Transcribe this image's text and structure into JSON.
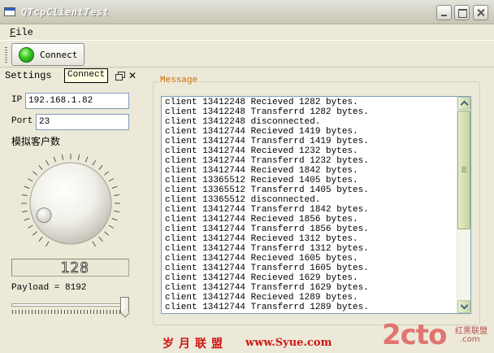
{
  "window": {
    "title": "QTcpClientTest"
  },
  "menu": {
    "file_accel": "F",
    "file_rest": "ile"
  },
  "toolbar": {
    "connect_label": "Connect"
  },
  "dock": {
    "title": "Settings",
    "tooltip": "Connect"
  },
  "settings": {
    "ip_label": "IP",
    "ip_value": "192.168.1.82",
    "port_label": "Port",
    "port_value": "23",
    "clients_label": "模拟客户数",
    "dial_value": 0.12,
    "lcd_value": "128",
    "payload_label": "Payload = 8192",
    "payload_slider_fraction": 1.0
  },
  "message": {
    "title": "Message",
    "lines": [
      "client 13412248 Recieved 1282 bytes.",
      "client 13412248 Transferrd 1282 bytes.",
      "client 13412248 disconnected.",
      "client 13412744 Recieved 1419 bytes.",
      "client 13412744 Transferrd 1419 bytes.",
      "client 13412744 Recieved 1232 bytes.",
      "client 13412744 Transferrd 1232 bytes.",
      "client 13412744 Recieved 1842 bytes.",
      "client 13365512 Recieved 1405 bytes.",
      "client 13365512 Transferrd 1405 bytes.",
      "client 13365512 disconnected.",
      "client 13412744 Transferrd 1842 bytes.",
      "client 13412744 Recieved 1856 bytes.",
      "client 13412744 Transferrd 1856 bytes.",
      "client 13412744 Recieved 1312 bytes.",
      "client 13412744 Transferrd 1312 bytes.",
      "client 13412744 Recieved 1605 bytes.",
      "client 13412744 Transferrd 1605 bytes.",
      "client 13412744 Recieved 1629 bytes.",
      "client 13412744 Transferrd 1629 bytes.",
      "client 13412744 Recieved 1289 bytes.",
      "client 13412744 Transferrd 1289 bytes."
    ]
  },
  "watermark": {
    "cn": "岁月联盟",
    "url": "www.Syue.com",
    "logo": "2cto",
    "logo_cn": "红黑联盟",
    "logo_com": ".com"
  },
  "colors": {
    "accent_orange": "#cd6c00",
    "led_green": "#35c51c",
    "watermark_red": "#d01515"
  }
}
